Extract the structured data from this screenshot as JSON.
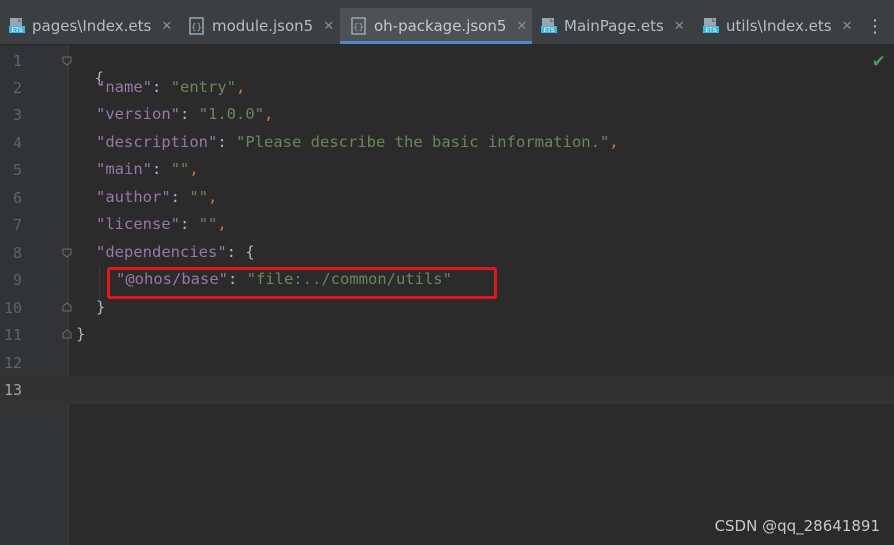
{
  "tabs": [
    {
      "label": "pages\\Index.ets",
      "icon": "ets-file-icon",
      "active": false
    },
    {
      "label": "module.json5",
      "icon": "json5-file-icon",
      "active": false
    },
    {
      "label": "oh-package.json5",
      "icon": "json5-file-icon",
      "active": true
    },
    {
      "label": "MainPage.ets",
      "icon": "ets-file-icon",
      "active": false
    },
    {
      "label": "utils\\Index.ets",
      "icon": "ets-file-icon",
      "active": false
    }
  ],
  "tab_close_symbol": "✕",
  "more_symbol": "⋮",
  "line_numbers": [
    "1",
    "2",
    "3",
    "4",
    "5",
    "6",
    "7",
    "8",
    "9",
    "10",
    "11",
    "12",
    "13"
  ],
  "code": {
    "l1": "{",
    "l2_key": "\"name\"",
    "l2_val": "\"entry\"",
    "l3_key": "\"version\"",
    "l3_val": "\"1.0.0\"",
    "l4_key": "\"description\"",
    "l4_val": "\"Please describe the basic information.\"",
    "l5_key": "\"main\"",
    "l5_val": "\"\"",
    "l6_key": "\"author\"",
    "l6_val": "\"\"",
    "l7_key": "\"license\"",
    "l7_val": "\"\"",
    "l8_key": "\"dependencies\"",
    "l8_brace": "{",
    "l9_key": "\"@ohos/base\"",
    "l9_val": "\"file:../common/utils\"",
    "l10": "}",
    "l11": "}",
    "colon": ":",
    "comma": ","
  },
  "status_check": "✔",
  "watermark": "CSDN @qq_28641891",
  "colors": {
    "key": "#9876aa",
    "string": "#6a8759",
    "punctuation": "#cc7832",
    "highlight_box": "#e3161c",
    "active_tab_underline": "#4a88c7"
  }
}
